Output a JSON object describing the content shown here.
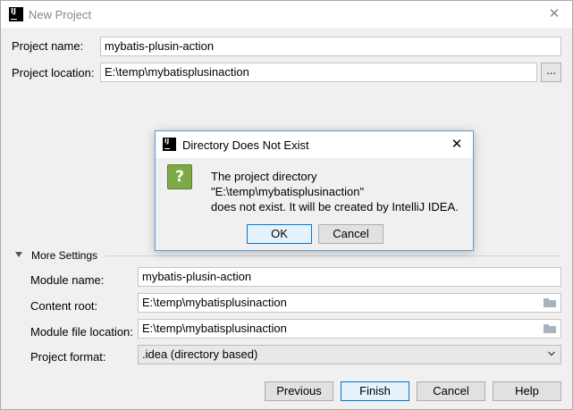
{
  "window": {
    "title": "New Project",
    "app_icon_text": "IJ"
  },
  "project": {
    "name_label": "Project name:",
    "name_value": "mybatis-plusin-action",
    "location_label": "Project location:",
    "location_value": "E:\\temp\\mybatisplusinaction",
    "browse_label": "..."
  },
  "more_settings": {
    "label": "More Settings",
    "module_name_label": "Module name:",
    "module_name_value": "mybatis-plusin-action",
    "content_root_label": "Content root:",
    "content_root_value": "E:\\temp\\mybatisplusinaction",
    "module_file_label": "Module file location:",
    "module_file_value": "E:\\temp\\mybatisplusinaction",
    "format_label": "Project format:",
    "format_value": ".idea (directory based)"
  },
  "buttons": {
    "previous": "Previous",
    "finish": "Finish",
    "cancel": "Cancel",
    "help": "Help"
  },
  "dialog": {
    "title": "Directory Does Not Exist",
    "icon_glyph": "?",
    "message_line1": "The project directory",
    "message_line2": "\"E:\\temp\\mybatisplusinaction\"",
    "message_line3": "does not exist. It will be created by IntelliJ IDEA.",
    "ok": "OK",
    "cancel": "Cancel"
  },
  "icons": {
    "app": "intellij-icon",
    "close": "close-icon",
    "folder": "folder-icon",
    "question": "question-icon",
    "chevron": "chevron-down-icon",
    "collapse": "triangle-down-icon"
  },
  "colors": {
    "accent": "#0078d7",
    "dialog_border": "#5b9bd5",
    "question_icon": "#7daa45"
  }
}
